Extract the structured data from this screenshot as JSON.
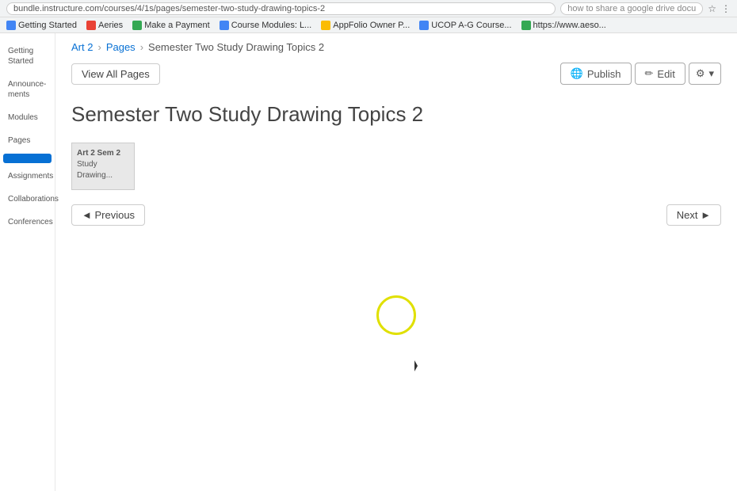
{
  "browser": {
    "url": "bundle.instructure.com/courses/4/1s/pages/semester-two-study-drawing-topics-2",
    "search_placeholder": "how to share a google drive document in canvas",
    "bookmarks": [
      {
        "label": "Getting Started",
        "color": "#4285f4"
      },
      {
        "label": "Aeries",
        "color": "#e94235"
      },
      {
        "label": "Make a Payment",
        "color": "#34a853"
      },
      {
        "label": "Course Modules: L...",
        "color": "#4285f4"
      },
      {
        "label": "AppFolio Owner P...",
        "color": "#fbbc04"
      },
      {
        "label": "UCOP A-G Course...",
        "color": "#4285f4"
      },
      {
        "label": "https://www.aeso...",
        "color": "#34a853"
      }
    ]
  },
  "breadcrumb": {
    "course": "Art 2",
    "section": "Pages",
    "current": "Semester Two Study Drawing Topics 2",
    "separator": "›"
  },
  "toolbar": {
    "view_all_pages": "View All Pages",
    "publish": "Publish",
    "edit": "Edit",
    "settings": "⚙",
    "settings_caret": "▾"
  },
  "page": {
    "title": "Semester Two Study Drawing Topics 2"
  },
  "content_card": {
    "line1": "Art 2 Sem 2",
    "line2": "Study",
    "line3": "Drawing..."
  },
  "navigation": {
    "previous": "◄ Previous",
    "next": "Next ►"
  },
  "sidebar": {
    "items": [
      {
        "label": "Getting\nStarted",
        "active": false
      },
      {
        "label": "Announcements",
        "active": false
      },
      {
        "label": "Modules",
        "active": false
      },
      {
        "label": "Pages",
        "active": false
      },
      {
        "label": "",
        "active": true
      },
      {
        "label": "Assignments",
        "active": false
      },
      {
        "label": "Collaborations",
        "active": false
      },
      {
        "label": "Conferences",
        "active": false
      }
    ]
  }
}
